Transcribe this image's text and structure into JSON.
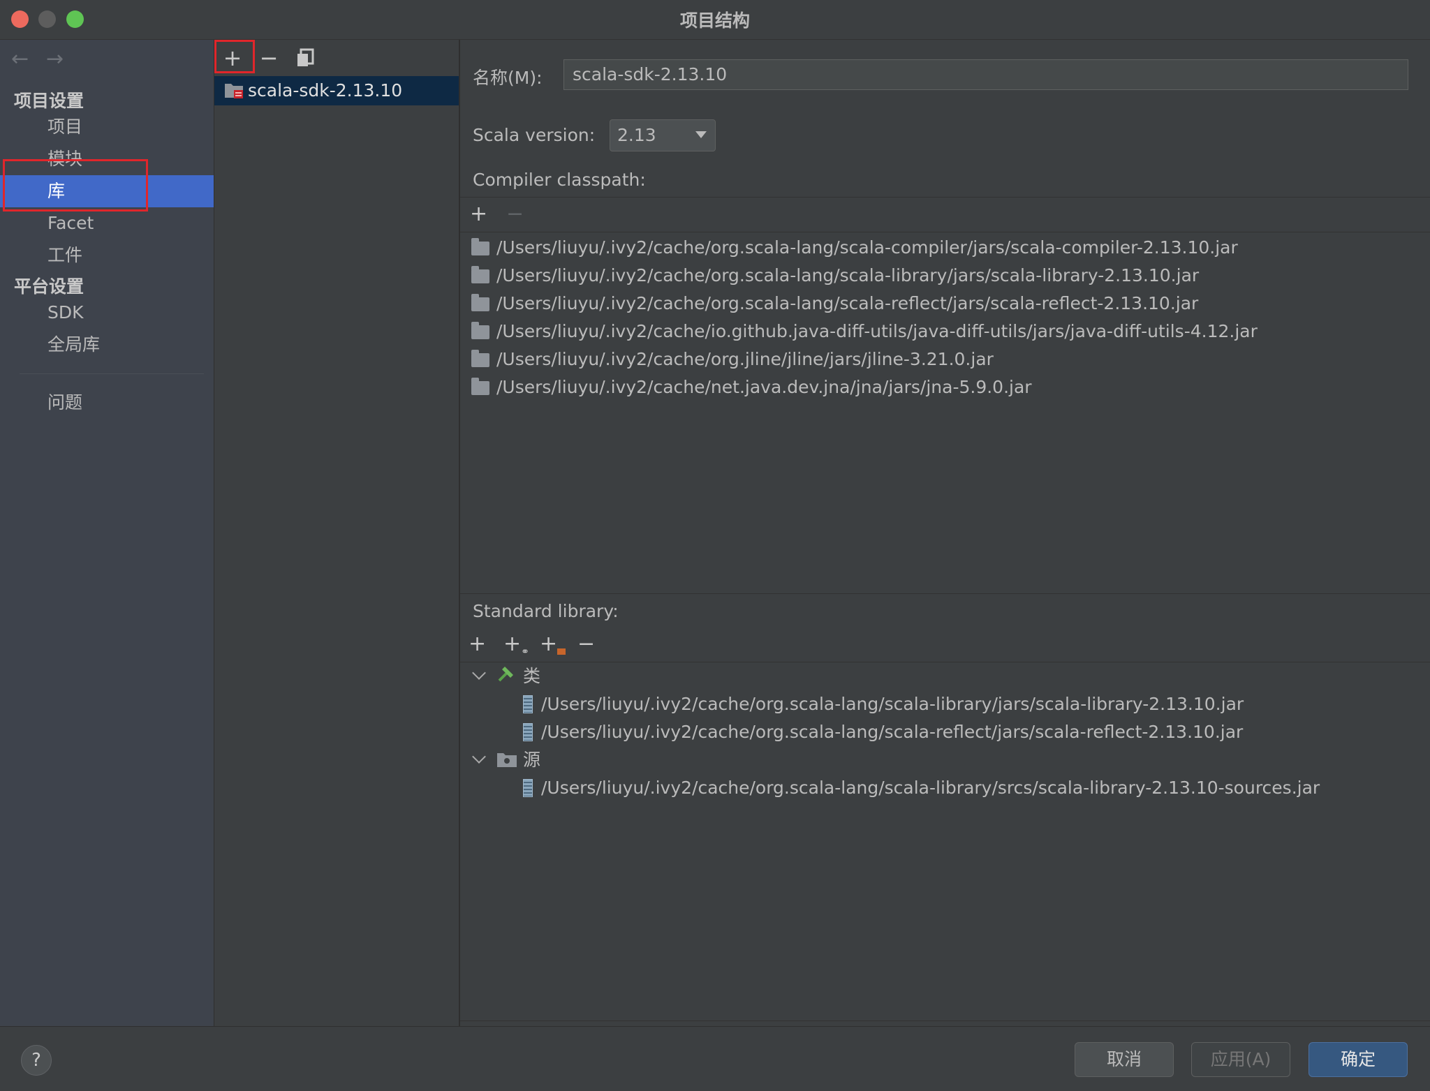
{
  "window": {
    "title": "项目结构",
    "colors": {
      "close": "#ed6a5e",
      "minimize": "#5d5d5d",
      "maximize": "#5fc454"
    }
  },
  "sidebar": {
    "back_icon": "arrow-left-icon",
    "forward_icon": "arrow-right-icon",
    "section_project": "项目设置",
    "section_platform": "平台设置",
    "items": [
      {
        "label": "项目"
      },
      {
        "label": "模块"
      },
      {
        "label": "库",
        "selected": true
      },
      {
        "label": "Facet"
      },
      {
        "label": "工件"
      },
      {
        "label": "SDK"
      },
      {
        "label": "全局库"
      },
      {
        "label": "问题"
      }
    ]
  },
  "library_list": {
    "toolbar": {
      "add": "+",
      "remove": "−",
      "copy_icon": "copy-icon"
    },
    "items": [
      {
        "label": "scala-sdk-2.13.10"
      }
    ]
  },
  "detail": {
    "name_label": "名称(M):",
    "name_value": "scala-sdk-2.13.10",
    "scala_version_label": "Scala version:",
    "scala_version_value": "2.13",
    "compiler_classpath_label": "Compiler classpath:",
    "compiler_toolbar": {
      "add": "+",
      "remove": "−"
    },
    "compiler_classpath": [
      "/Users/liuyu/.ivy2/cache/org.scala-lang/scala-compiler/jars/scala-compiler-2.13.10.jar",
      "/Users/liuyu/.ivy2/cache/org.scala-lang/scala-library/jars/scala-library-2.13.10.jar",
      "/Users/liuyu/.ivy2/cache/org.scala-lang/scala-reflect/jars/scala-reflect-2.13.10.jar",
      "/Users/liuyu/.ivy2/cache/io.github.java-diff-utils/java-diff-utils/jars/java-diff-utils-4.12.jar",
      "/Users/liuyu/.ivy2/cache/org.jline/jline/jars/jline-3.21.0.jar",
      "/Users/liuyu/.ivy2/cache/net.java.dev.jna/jna/jars/jna-5.9.0.jar"
    ],
    "standard_library_label": "Standard library:",
    "standard_toolbar": {
      "add": "+",
      "add_url_icon": "add-url-icon",
      "add_folder_icon": "add-folder-icon",
      "remove": "−"
    },
    "tree": {
      "classes_label": "类",
      "classes": [
        "/Users/liuyu/.ivy2/cache/org.scala-lang/scala-library/jars/scala-library-2.13.10.jar",
        "/Users/liuyu/.ivy2/cache/org.scala-lang/scala-reflect/jars/scala-reflect-2.13.10.jar"
      ],
      "sources_label": "源",
      "sources": [
        "/Users/liuyu/.ivy2/cache/org.scala-lang/scala-library/srcs/scala-library-2.13.10-sources.jar"
      ]
    }
  },
  "footer": {
    "help": "?",
    "cancel": "取消",
    "apply": "应用(A)",
    "ok": "确定"
  }
}
